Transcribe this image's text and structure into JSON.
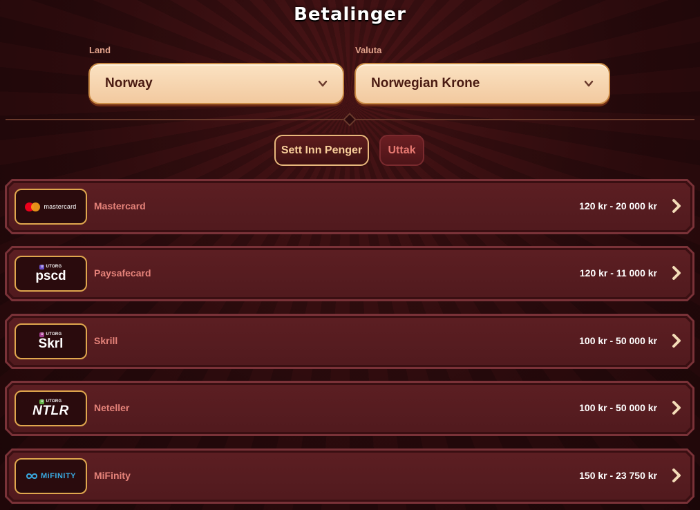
{
  "title": "Betalinger",
  "land": {
    "label": "Land",
    "value": "Norway"
  },
  "valuta": {
    "label": "Valuta",
    "value": "Norwegian Krone"
  },
  "tabs": {
    "deposit": "Sett Inn Penger",
    "withdraw": "Uttak"
  },
  "methods": [
    {
      "name": "Mastercard",
      "range": "120 kr - 20 000 kr",
      "logo_text": "mastercard"
    },
    {
      "name": "Paysafecard",
      "range": "120 kr - 11 000 kr",
      "badge": "UTORG",
      "logo_text": "pscd"
    },
    {
      "name": "Skrill",
      "range": "100 kr - 50 000 kr",
      "badge": "UTORG",
      "logo_text": "Skrl"
    },
    {
      "name": "Neteller",
      "range": "100 kr - 50 000 kr",
      "badge": "UTORG",
      "logo_text": "NTLR"
    },
    {
      "name": "MiFinity",
      "range": "150 kr - 23 750 kr",
      "logo_text": "MiFINITY"
    }
  ]
}
